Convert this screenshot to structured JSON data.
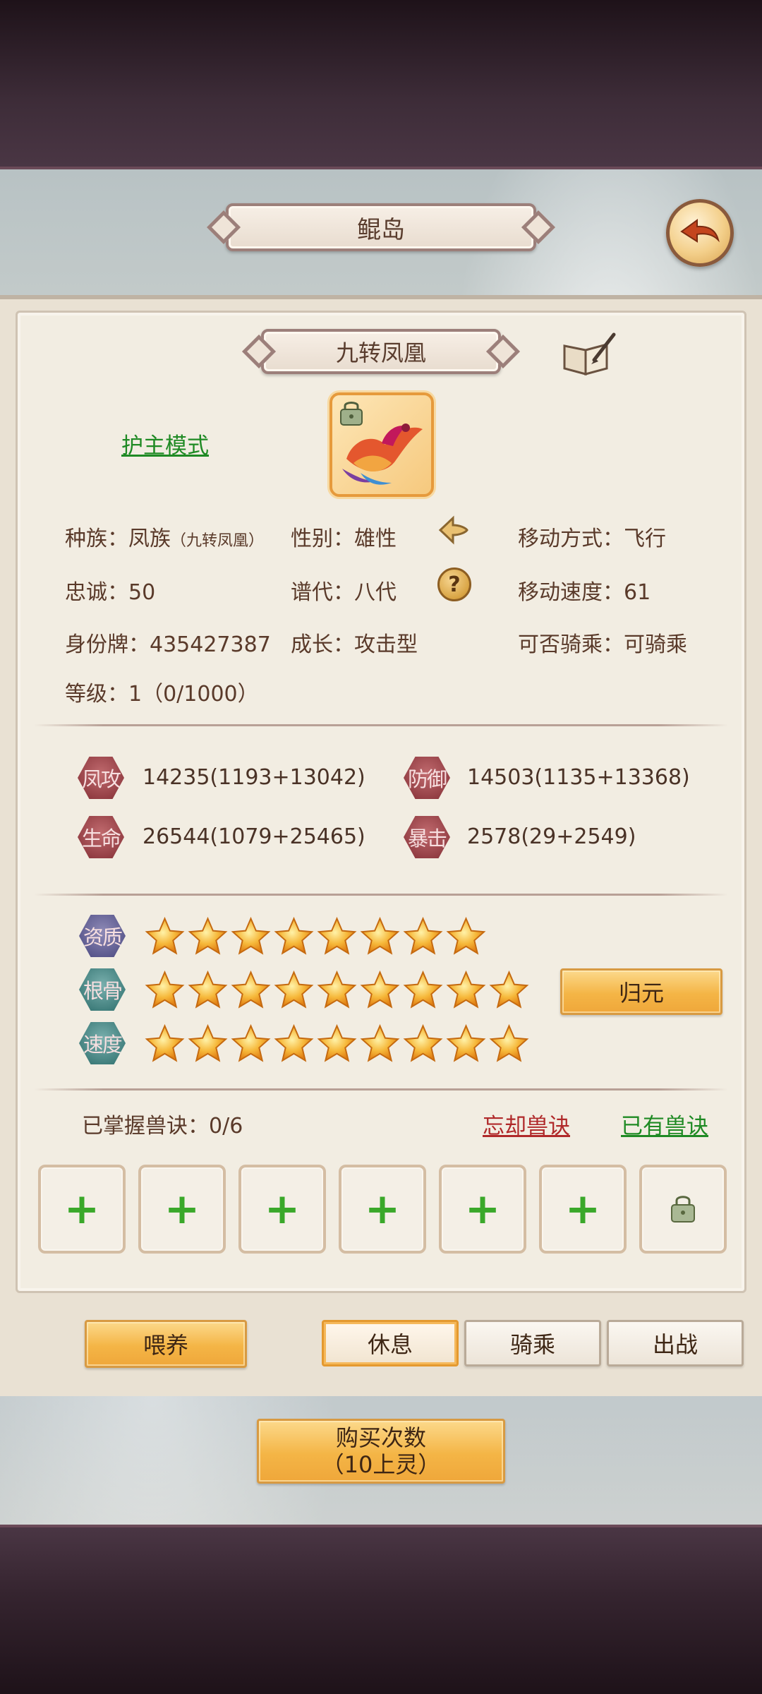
{
  "header": {
    "title": "鲲岛"
  },
  "pet": {
    "name": "九转凤凰",
    "guard_mode_label": "护主模式"
  },
  "info": {
    "race": "种族：凤族",
    "race_sub": "（九转凤凰）",
    "gender": "性别：雄性",
    "move_type": "移动方式：飞行",
    "loyalty": "忠诚：50",
    "generation": "谱代：八代",
    "move_speed": "移动速度：61",
    "id_tag": "身份牌：435427387",
    "growth": "成长：攻击型",
    "rideable": "可否骑乘：可骑乘",
    "level": "等级：1（0/1000）"
  },
  "stats": {
    "attack_label": "凤攻",
    "attack_value": "14235(1193+13042)",
    "defense_label": "防御",
    "defense_value": "14503(1135+13368)",
    "life_label": "生命",
    "life_value": "26544(1079+25465)",
    "crit_label": "暴击",
    "crit_value": "2578(29+2549)"
  },
  "aptitude": {
    "quality_label": "资质",
    "quality_stars": 8,
    "bone_label": "根骨",
    "bone_stars": 9,
    "speed_label": "速度",
    "speed_stars": 9,
    "reset_button": "归元"
  },
  "skills": {
    "mastered": "已掌握兽诀：0/6",
    "forget_link": "忘却兽诀",
    "owned_link": "已有兽诀"
  },
  "actions": {
    "feed": "喂养",
    "rest": "休息",
    "ride": "骑乘",
    "battle": "出战"
  },
  "purchase": {
    "line1": "购买次数",
    "line2": "（10上灵）"
  },
  "colors": {
    "gold": "#f4b546",
    "green_link": "#1f8a24",
    "red_link": "#b0292a"
  }
}
